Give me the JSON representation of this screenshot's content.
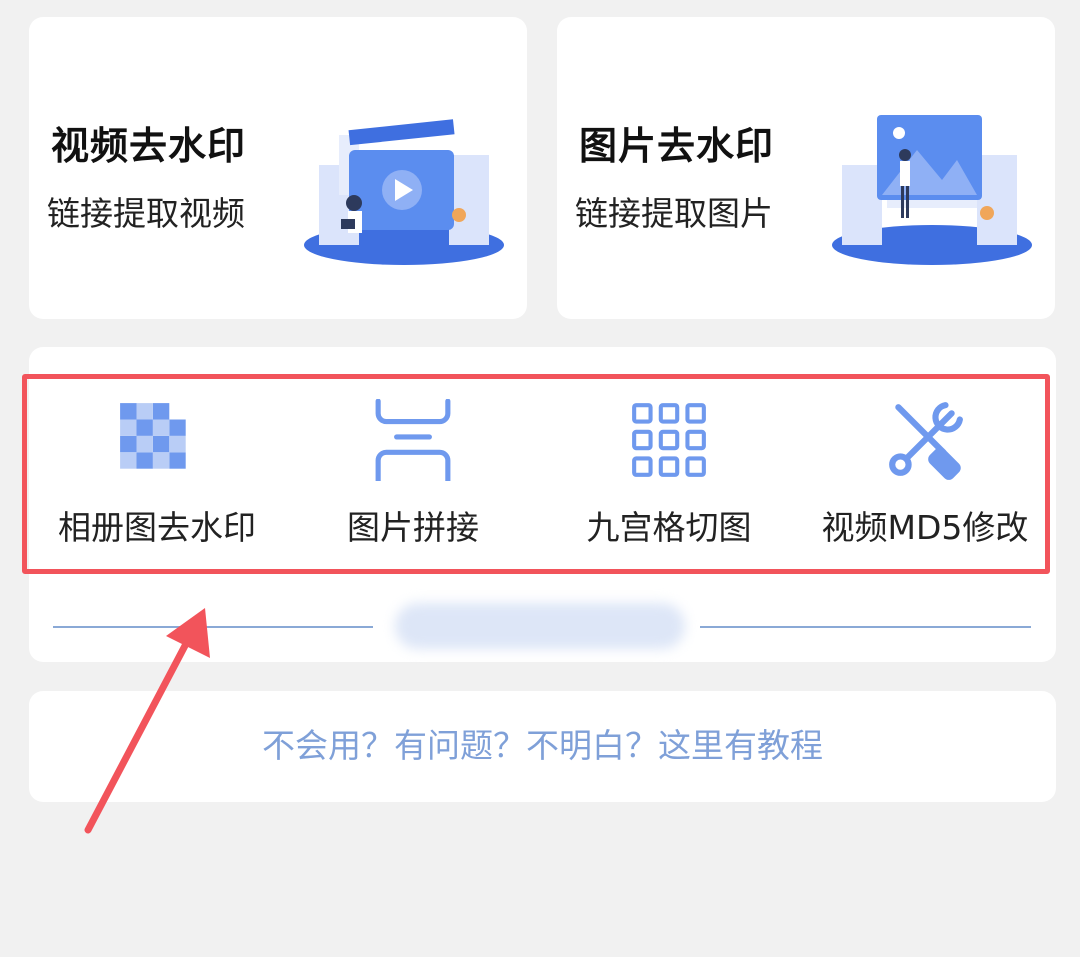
{
  "cards": {
    "video": {
      "title": "视频去水印",
      "subtitle": "链接提取视频"
    },
    "image": {
      "title": "图片去水印",
      "subtitle": "链接提取图片"
    }
  },
  "tools": [
    {
      "label": "相册图去水印",
      "icon": "checkerboard-icon"
    },
    {
      "label": "图片拼接",
      "icon": "image-stitch-icon"
    },
    {
      "label": "九宫格切图",
      "icon": "grid-nine-icon"
    },
    {
      "label": "视频MD5修改",
      "icon": "wrench-screwdriver-icon"
    }
  ],
  "help": {
    "text": "不会用？有问题？不明白？这里有教程"
  },
  "colors": {
    "accent_blue": "#5b8def",
    "highlight_red": "#f2545b",
    "help_text": "#7fa0d8",
    "background": "#f1f1f1"
  }
}
